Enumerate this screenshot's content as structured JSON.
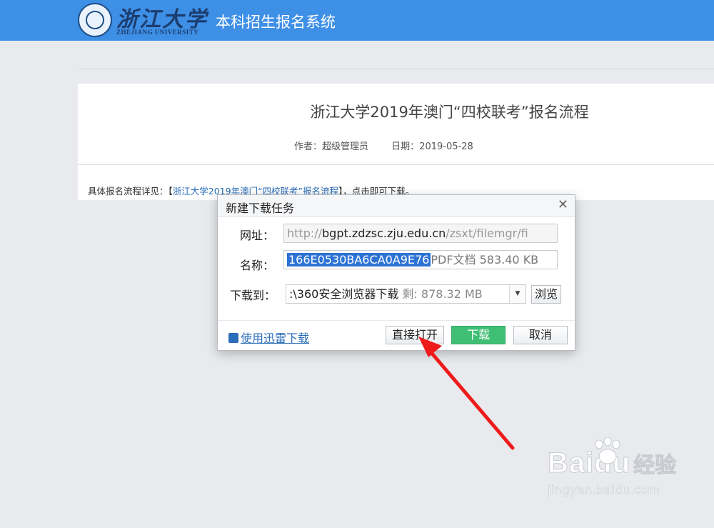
{
  "header": {
    "logo_cn": "浙江大学",
    "logo_en": "ZHEJIANG UNIVERSITY",
    "system_title": "本科招生报名系统",
    "bg_color": "#3e8fe6"
  },
  "article": {
    "title": "浙江大学2019年澳门“四校联考”报名流程",
    "author_label": "作者：",
    "author": "超级管理员",
    "date_label": "日期：",
    "date": "2019-05-28",
    "body_prefix": "具体报名流程详见：【",
    "body_link": "浙江大学2019年澳门“四校联考”报名流程",
    "body_suffix": "】，点击即可下载。"
  },
  "dialog": {
    "title": "新建下载任务",
    "close_icon": "close-icon",
    "url_label": "网址：",
    "url_prefix": "http://",
    "url_host": "bgpt.zdzsc.zju.edu.cn",
    "url_path": "/zsxt/filemgr/fi",
    "name_label": "名称：",
    "name_selected": "166E0530BA6CA0A9E76",
    "name_rest": "PDF文档 583.40 KB",
    "save_label": "下载到：",
    "save_path": ":\\360安全浏览器下载",
    "save_free": "剩: 878.32 MB",
    "browse_button": "浏览",
    "xunlei_link": "使用迅雷下载",
    "open_button": "直接打开",
    "download_button": "下载",
    "cancel_button": "取消",
    "primary_color": "#3fbf74"
  },
  "watermark": {
    "brand": "Bai",
    "brand_tail": "du",
    "brand_cn": "经验",
    "url": "jingyan.baidu.com"
  }
}
